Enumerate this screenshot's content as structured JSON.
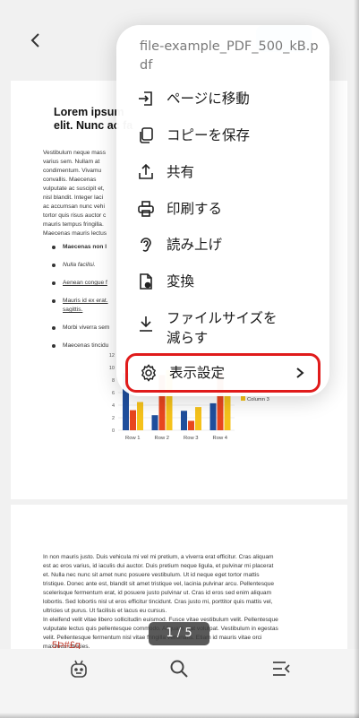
{
  "menu": {
    "title": "file-example_PDF_500_kB.pdf",
    "items": [
      {
        "label": "ページに移動",
        "icon": "goto-page-icon"
      },
      {
        "label": "コピーを保存",
        "icon": "copy-icon"
      },
      {
        "label": "共有",
        "icon": "share-icon"
      },
      {
        "label": "印刷する",
        "icon": "print-icon"
      },
      {
        "label": "読み上げ",
        "icon": "read-aloud-icon"
      },
      {
        "label": "変換",
        "icon": "convert-icon"
      },
      {
        "label": "ファイルサイズを\n減らす",
        "icon": "reduce-size-icon"
      },
      {
        "label": "表示設定",
        "icon": "settings-icon"
      }
    ]
  },
  "document": {
    "title": "Lorem ipsum\nelit. Nunc ac fa",
    "para1": "Vestibulum neque mass\nvarius sem. Nullam at\ncondimentum. Vivamu\nconvallis. Maecenas\nvulputate ac suscipit et,\nnisl blandit. Integer laci\nac accumsan nunc vehi\ntortor quis risus auctor c\nmauris tempus fringilla.",
    "para2": "Maecenas mauris lectus",
    "list": [
      "Maecenas non l",
      "Nulla facilisi.",
      "Aenean congue f",
      "Mauris id ex erat.\nsagittis.",
      "Morbi viverra sem",
      "Maecenas tincidu"
    ],
    "page2_para1": "In non mauris justo. Duis vehicula mi vel mi pretium, a viverra erat efficitur. Cras aliquam\nest ac eros varius, id iaculis dui auctor. Duis pretium neque ligula, et pulvinar mi placerat\net. Nulla nec nunc sit amet nunc posuere vestibulum. Ut id neque eget tortor mattis\ntristique. Donec ante est, blandit sit amet tristique vel, lacinia pulvinar arcu. Pellentesque\nscelerisque fermentum erat, id posuere justo pulvinar ut. Cras id eros sed enim aliquam\nlobortis. Sed lobortis nisl ut eros efficitur tincidunt. Cras justo mi, porttitor quis mattis vel,\nultricies ut purus. Ut facilisis et lacus eu cursus.",
    "page2_para2": "In eleifend velit vitae libero sollicitudin euismod. Fusce vitae vestibulum velit. Pellentesque\nvulputate lectus quis pellentesque commodo. Aliquam erat volutpat. Vestibulum in egestas\nvelit. Pellentesque fermentum nisl vitae fringilla venenatis. Etiam id mauris vitae orci\nmaximus ultricies.",
    "partial_red": "5Þ#£g"
  },
  "chart_data": {
    "type": "bar",
    "categories": [
      "Row 1",
      "Row 2",
      "Row 3",
      "Row 4"
    ],
    "series": [
      {
        "values": [
          9.1,
          2.4,
          3.1,
          4.3
        ],
        "color": "#1f4e9c"
      },
      {
        "values": [
          3.2,
          8.8,
          1.5,
          9.0
        ],
        "color": "#e8461e"
      },
      {
        "values": [
          4.5,
          9.6,
          3.7,
          6.2
        ],
        "color": "#f5c21b"
      }
    ],
    "legend_visible": [
      "Column 3"
    ],
    "yticks": [
      "12",
      "10",
      "8",
      "6",
      "4",
      "2",
      "0"
    ],
    "ylim": [
      0,
      12
    ]
  },
  "pager": {
    "text": "1 / 5"
  },
  "colors": {
    "highlight": "#e01b1b",
    "accent": "#b8d4f6"
  }
}
